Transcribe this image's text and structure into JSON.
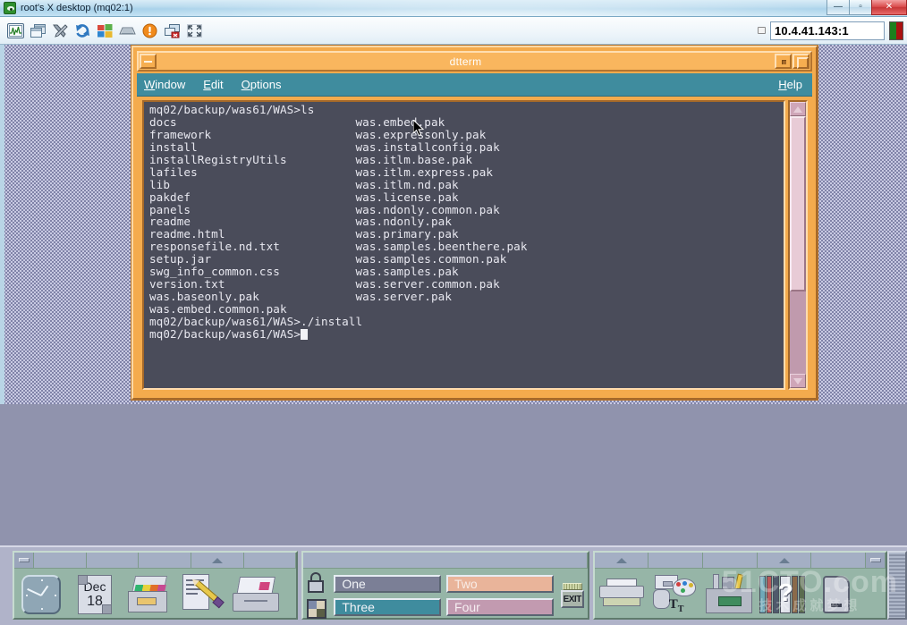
{
  "window": {
    "title": "root's X desktop (mq02:1)",
    "app_icon": "eye-icon",
    "buttons": {
      "minimize": "—",
      "maximize": "▫",
      "close": "✕"
    }
  },
  "toolbar": {
    "icons": [
      {
        "name": "monitor-graph-icon",
        "label": "Monitor"
      },
      {
        "name": "windows-copy-icon",
        "label": "Windows"
      },
      {
        "name": "tools-icon",
        "label": "Tools"
      },
      {
        "name": "refresh-icon",
        "label": "Refresh"
      },
      {
        "name": "start-menu-icon",
        "label": "Start"
      },
      {
        "name": "keyboard-icon",
        "label": "Keyboard"
      },
      {
        "name": "alert-icon",
        "label": "Alert"
      },
      {
        "name": "disconnect-icon",
        "label": "Disconnect"
      },
      {
        "name": "fullscreen-icon",
        "label": "Full screen"
      }
    ],
    "address_value": "10.4.41.143:1",
    "status_dot": "connection-dot"
  },
  "dtterm": {
    "title": "dtterm",
    "menus": [
      {
        "label": "Window",
        "mnemonic": "W"
      },
      {
        "label": "Edit",
        "mnemonic": "E"
      },
      {
        "label": "Options",
        "mnemonic": "O"
      }
    ],
    "help_label": "Help",
    "titlebar_buttons": {
      "menu": "window-menu-button",
      "minimize": "minimize-button",
      "maximize": "maximize-button"
    },
    "terminal": {
      "lines": [
        {
          "left": "mq02/backup/was61/WAS>ls",
          "right": ""
        },
        {
          "left": "docs",
          "right": "was.embed.pak"
        },
        {
          "left": "framework",
          "right": "was.expressonly.pak"
        },
        {
          "left": "install",
          "right": "was.installconfig.pak"
        },
        {
          "left": "installRegistryUtils",
          "right": "was.itlm.base.pak"
        },
        {
          "left": "lafiles",
          "right": "was.itlm.express.pak"
        },
        {
          "left": "lib",
          "right": "was.itlm.nd.pak"
        },
        {
          "left": "pakdef",
          "right": "was.license.pak"
        },
        {
          "left": "panels",
          "right": "was.ndonly.common.pak"
        },
        {
          "left": "readme",
          "right": "was.ndonly.pak"
        },
        {
          "left": "readme.html",
          "right": "was.primary.pak"
        },
        {
          "left": "responsefile.nd.txt",
          "right": "was.samples.beenthere.pak"
        },
        {
          "left": "setup.jar",
          "right": "was.samples.common.pak"
        },
        {
          "left": "swg_info_common.css",
          "right": "was.samples.pak"
        },
        {
          "left": "version.txt",
          "right": "was.server.common.pak"
        },
        {
          "left": "was.baseonly.pak",
          "right": "was.server.pak"
        },
        {
          "left": "was.embed.common.pak",
          "right": ""
        },
        {
          "left": "mq02/backup/was61/WAS>./install",
          "right": ""
        }
      ],
      "prompt": "mq02/backup/was61/WAS>",
      "background": "#4a4c5a",
      "foreground": "#e8e8f0"
    },
    "scrollbar": {
      "up": "scroll-up-arrow",
      "down": "scroll-down-arrow",
      "thumb": "scroll-thumb"
    }
  },
  "frontpanel": {
    "left": {
      "items": [
        {
          "name": "clock-icon",
          "label": "Clock"
        },
        {
          "name": "calendar-icon",
          "label": "Calendar",
          "month": "Dec",
          "day": "18"
        },
        {
          "name": "file-manager-icon",
          "label": "File Manager"
        },
        {
          "name": "text-editor-icon",
          "label": "Text Editor"
        },
        {
          "name": "mailer-icon",
          "label": "Mailer"
        }
      ]
    },
    "switch": {
      "lock_label": "Lock",
      "workspaces": [
        {
          "label": "One",
          "color": "#7b7f96",
          "selected": true
        },
        {
          "label": "Two",
          "color": "#e9b49a",
          "selected": false
        },
        {
          "label": "Three",
          "color": "#3f8c9e",
          "selected": false
        },
        {
          "label": "Four",
          "color": "#c29ab0",
          "selected": false
        }
      ],
      "busy_label": "Busy",
      "exit_label": "EXIT"
    },
    "right": {
      "items": [
        {
          "name": "printer-icon",
          "label": "Printer"
        },
        {
          "name": "style-manager-icon",
          "label": "Style Manager"
        },
        {
          "name": "application-manager-icon",
          "label": "Application Manager"
        },
        {
          "name": "help-manager-icon",
          "label": "Help Manager"
        },
        {
          "name": "trash-icon",
          "label": "Trash"
        }
      ]
    }
  },
  "watermark": {
    "text": "51CTO",
    "suffix": ".com",
    "sub": "技术成就梦想"
  },
  "colors": {
    "desktop": "#9093ad",
    "dtterm_frame": "#f4ab4d",
    "dtterm_menubar": "#3f8c9e",
    "panel": "#96b5a7",
    "terminal_bg": "#4a4c5a"
  }
}
